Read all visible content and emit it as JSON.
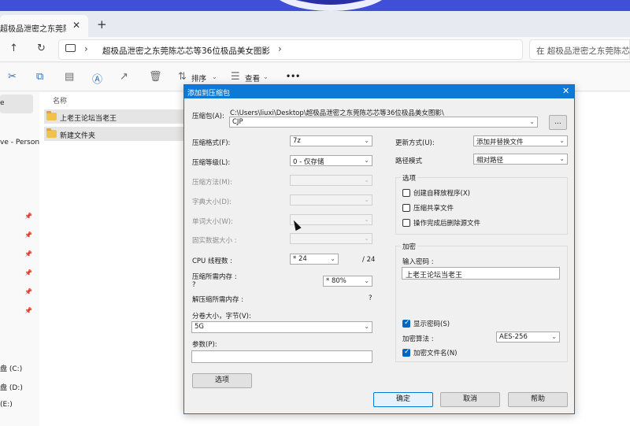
{
  "explorer": {
    "tab_title": "超极品泄密之东莞陈芯芯等36位",
    "breadcrumb": "超极品泄密之东莞陈芯芯等36位极品美女图影",
    "search_placeholder": "在 超极品泄密之东莞陈芯芯",
    "toolbar": {
      "sort_label": "排序",
      "view_label": "查看",
      "more_label": "•••"
    },
    "left_pane": [
      "e",
      "ve - Person",
      "盘 (C:)",
      "盘 (D:)",
      "(E:)"
    ],
    "column_name": "名称",
    "files": [
      "上老王论坛当老王",
      "新建文件夹"
    ]
  },
  "dialog": {
    "title": "添加到压缩包",
    "archive_label": "压缩包(A):",
    "archive_path": "C:\\Users\\liuxi\\Desktop\\超极品泄密之东莞陈芯芯等36位极品美女图影\\",
    "archive_name": "CJP",
    "browse_label": "...",
    "format_label": "压缩格式(F):",
    "format_value": "7z",
    "level_label": "压缩等级(L):",
    "level_value": "0 - 仅存储",
    "method_label": "压缩方法(M):",
    "dict_label": "字典大小(D):",
    "word_label": "单词大小(W):",
    "solid_label": "固实数据大小 :",
    "threads_label": "CPU 线程数 :",
    "threads_value": "* 24",
    "threads_max": "/ 24",
    "mem_comp_label": "压缩所需内存 :",
    "mem_comp_value": "?",
    "mem_percent": "* 80%",
    "mem_decomp_label": "解压缩所需内存 :",
    "mem_decomp_value": "?",
    "volume_label": "分卷大小，字节(V):",
    "volume_value": "5G",
    "params_label": "参数(P):",
    "options_button": "选项",
    "update_label": "更新方式(U):",
    "update_value": "添加并替换文件",
    "path_label": "路径模式",
    "path_value": "相对路径",
    "options_group": "选项",
    "opt_sfx": "创建自释放程序(X)",
    "opt_shared": "压缩共享文件",
    "opt_delete": "操作完成后删除源文件",
    "encrypt_group": "加密",
    "password_label": "输入密码 :",
    "password_value": "上老王论坛当老王",
    "show_password": "显示密码(S)",
    "enc_method_label": "加密算法 :",
    "enc_method_value": "AES-256",
    "encrypt_names": "加密文件名(N)",
    "ok": "确定",
    "cancel": "取消",
    "help": "帮助"
  }
}
